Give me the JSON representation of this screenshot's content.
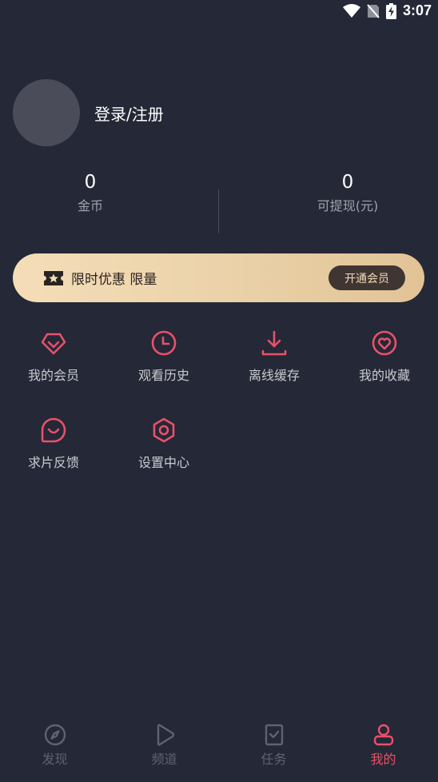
{
  "status_bar": {
    "time": "3:07"
  },
  "profile": {
    "login_text": "登录/注册"
  },
  "stats": {
    "coins": {
      "value": "0",
      "label": "金币"
    },
    "withdrawable": {
      "value": "0",
      "label": "可提现(元)"
    }
  },
  "vip_banner": {
    "text": "限时优惠 限量",
    "button_label": "开通会员"
  },
  "grid": [
    {
      "label": "我的会员",
      "icon": "vip-diamond-icon"
    },
    {
      "label": "观看历史",
      "icon": "clock-icon"
    },
    {
      "label": "离线缓存",
      "icon": "download-icon"
    },
    {
      "label": "我的收藏",
      "icon": "heart-icon"
    },
    {
      "label": "求片反馈",
      "icon": "feedback-icon"
    },
    {
      "label": "设置中心",
      "icon": "settings-icon"
    }
  ],
  "tabs": [
    {
      "label": "发现",
      "icon": "compass-icon",
      "active": false
    },
    {
      "label": "频道",
      "icon": "play-icon",
      "active": false
    },
    {
      "label": "任务",
      "icon": "task-icon",
      "active": false
    },
    {
      "label": "我的",
      "icon": "user-icon",
      "active": true
    }
  ],
  "colors": {
    "background": "#252836",
    "accent": "#e8516a",
    "banner_gold": "#f4ddb8",
    "tab_inactive": "#5f6270"
  }
}
